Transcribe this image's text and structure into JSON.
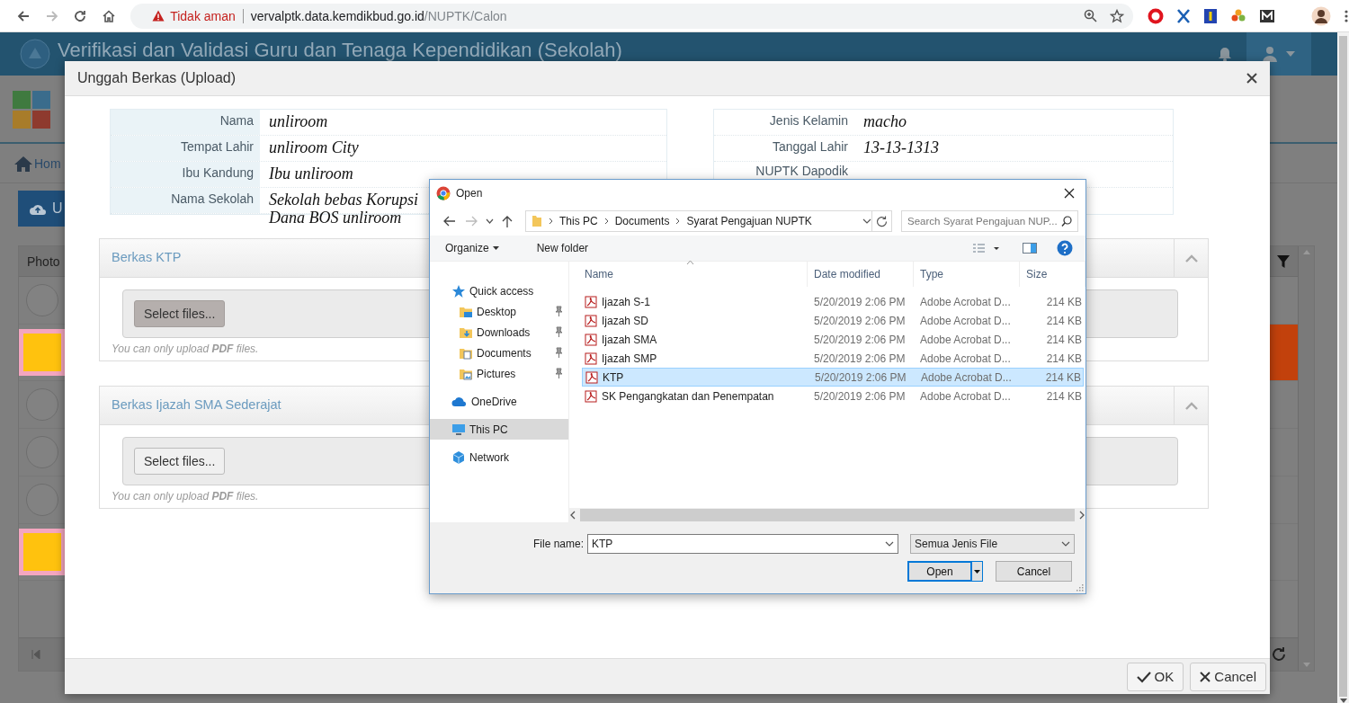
{
  "browser": {
    "security": "Tidak aman",
    "host": "vervalptk.data.kemdikbud.go.id",
    "path": "/NUPTK/Calon"
  },
  "app": {
    "title": "Verifikasi dan Validasi Guru dan Tenaga Kependidikan (Sekolah)",
    "nav": "Hom",
    "action": "U",
    "table": {
      "columns": [
        "Photo"
      ],
      "rows": [
        {
          "kind": "avatar",
          "selected": false
        },
        {
          "kind": "photo",
          "selected": true
        },
        {
          "kind": "avatar",
          "selected": false
        },
        {
          "kind": "avatar",
          "selected": false
        },
        {
          "kind": "avatar",
          "selected": false
        },
        {
          "kind": "photo",
          "selected": false
        }
      ]
    }
  },
  "modal": {
    "title": "Unggah Berkas (Upload)",
    "info_left": [
      {
        "label": "Nama",
        "value": "unliroom"
      },
      {
        "label": "Tempat Lahir",
        "value": "unliroom City"
      },
      {
        "label": "Ibu Kandung",
        "value": "Ibu unliroom"
      },
      {
        "label": "Nama Sekolah",
        "value": "Sekolah bebas Korupsi Dana BOS unliroom"
      }
    ],
    "info_right": [
      {
        "label": "Jenis Kelamin",
        "value": "macho"
      },
      {
        "label": "Tanggal Lahir",
        "value": "13-13-1313"
      },
      {
        "label": "NUPTK Dapodik"
      }
    ],
    "panels": [
      {
        "title": "Berkas KTP",
        "button": "Select files...",
        "hover": true,
        "hint": "You can only upload **PDF** files."
      },
      {
        "title": "Berkas Ijazah SMA Sederajat",
        "button": "Select files...",
        "hover": false,
        "hint": "You can only upload **PDF** files."
      }
    ],
    "buttons": [
      {
        "kind": "ok",
        "label": "OK"
      },
      {
        "kind": "cancel",
        "label": "Cancel"
      }
    ]
  },
  "dialog": {
    "title": "Open",
    "breadcrumb": [
      "This PC",
      "Documents",
      "Syarat Pengajuan NUPTK"
    ],
    "search_placeholder": "Search Syarat Pengajuan NUP...",
    "toolbar": [
      {
        "label": "Organize",
        "menu": true
      },
      {
        "label": "New folder",
        "menu": false
      }
    ],
    "nav": [
      {
        "label": "Quick access",
        "kind": "star",
        "selected": false,
        "children": [
          {
            "label": "Desktop",
            "kind": "desktop",
            "pinned": true,
            "selected": false
          },
          {
            "label": "Downloads",
            "kind": "downloads",
            "pinned": true,
            "selected": false
          },
          {
            "label": "Documents",
            "kind": "documents",
            "pinned": true,
            "selected": false
          },
          {
            "label": "Pictures",
            "kind": "pictures",
            "pinned": true,
            "selected": false
          }
        ]
      },
      {
        "label": "OneDrive",
        "kind": "cloud",
        "selected": false
      },
      {
        "label": "This PC",
        "kind": "pc",
        "selected": true
      },
      {
        "label": "Network",
        "kind": "network",
        "selected": false
      }
    ],
    "columns": [
      "Name",
      "Date modified",
      "Type",
      "Size"
    ],
    "files": [
      {
        "name": "Ijazah S-1",
        "date": "5/20/2019 2:06 PM",
        "type": "Adobe Acrobat D...",
        "size": "214 KB",
        "selected": false
      },
      {
        "name": "Ijazah SD",
        "date": "5/20/2019 2:06 PM",
        "type": "Adobe Acrobat D...",
        "size": "214 KB",
        "selected": false
      },
      {
        "name": "Ijazah SMA",
        "date": "5/20/2019 2:06 PM",
        "type": "Adobe Acrobat D...",
        "size": "214 KB",
        "selected": false
      },
      {
        "name": "Ijazah SMP",
        "date": "5/20/2019 2:06 PM",
        "type": "Adobe Acrobat D...",
        "size": "214 KB",
        "selected": false
      },
      {
        "name": "KTP",
        "date": "5/20/2019 2:06 PM",
        "type": "Adobe Acrobat D...",
        "size": "214 KB",
        "selected": true
      },
      {
        "name": "SK Pengangkatan dan Penempatan",
        "date": "5/20/2019 2:06 PM",
        "type": "Adobe Acrobat D...",
        "size": "214 KB",
        "selected": false
      }
    ],
    "file_name_label": "File name:",
    "file_name": "KTP",
    "file_type": "Semua Jenis File",
    "buttons": [
      {
        "kind": "open",
        "label": "Open"
      },
      {
        "kind": "cancel",
        "label": "Cancel"
      }
    ]
  }
}
